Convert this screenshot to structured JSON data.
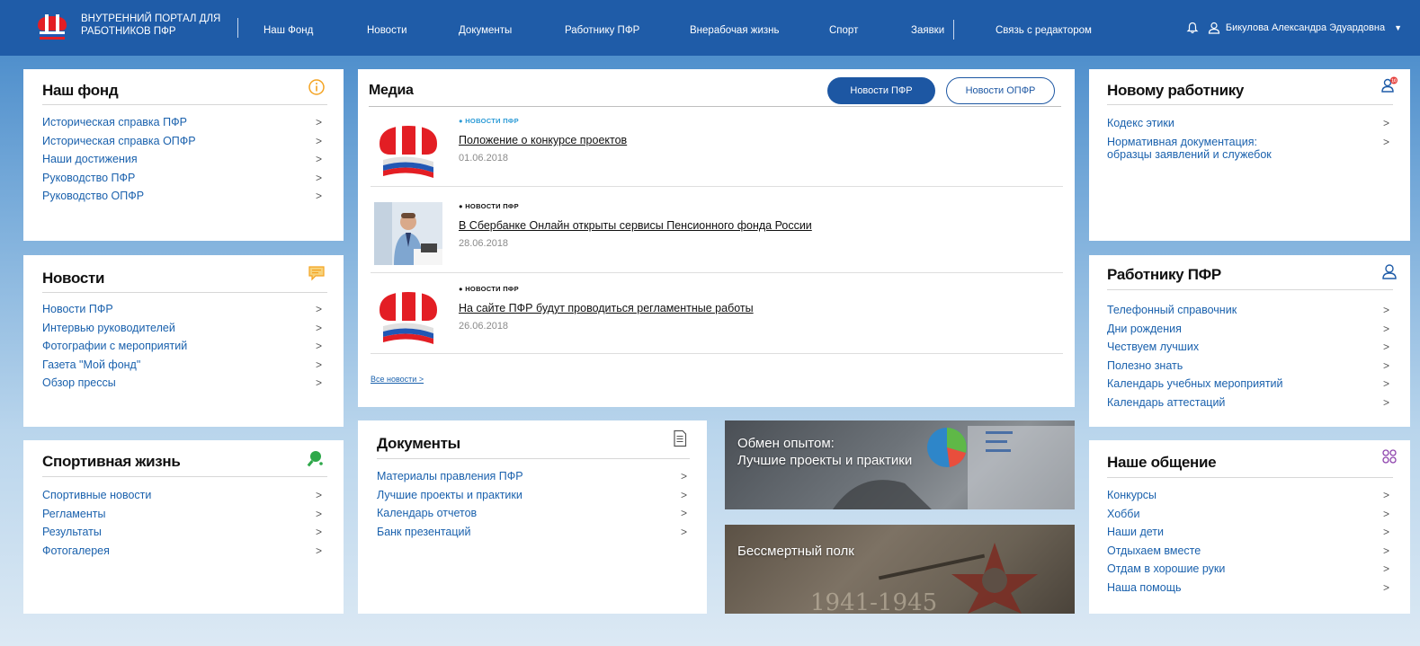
{
  "header": {
    "brand_line1": "ВНУТРЕННИЙ ПОРТАЛ ДЛЯ",
    "brand_line2": "РАБОТНИКОВ ПФР",
    "nav": [
      "Наш Фонд",
      "Новости",
      "Документы",
      "Работнику ПФР",
      "Внерабочая жизнь",
      "Спорт",
      "Заявки",
      "Связь с редактором"
    ],
    "user_name": "Бикулова Александра Эдуардовна",
    "icons": {
      "notifications": "bell-icon",
      "user": "user-icon",
      "menu": "caret-down-icon"
    }
  },
  "nash_fond": {
    "title": "Наш фонд",
    "icon": "info-icon",
    "links": [
      "Историческая справка ПФР",
      "Историческая справка ОПФР",
      "Наши достижения",
      "Руководство ПФР",
      "Руководство ОПФР"
    ]
  },
  "novosti": {
    "title": "Новости",
    "icon": "chat-icon",
    "links": [
      "Новости ПФР",
      "Интервью руководителей",
      "Фотографии с мероприятий",
      "Газета \"Мой фонд\"",
      "Обзор прессы"
    ]
  },
  "sport": {
    "title": "Спортивная жизнь",
    "icon": "ping-pong-icon",
    "links": [
      "Спортивные новости",
      "Регламенты",
      "Результаты",
      "Фотогалерея"
    ]
  },
  "media": {
    "title": "Медиа",
    "tab_pfr": "Новости ПФР",
    "tab_opfr": "Новости ОПФР",
    "items": [
      {
        "tag": "● НОВОСТИ ПФР",
        "headline": "Положение о конкурсе проектов",
        "date": "01.06.2018",
        "thumb": "pfr-logo"
      },
      {
        "tag": "● НОВОСТИ ПФР",
        "headline": "В Сбербанке Онлайн открыты сервисы Пенсионного фонда России",
        "date": "28.06.2018",
        "thumb": "photo-man-at-desk"
      },
      {
        "tag": "● НОВОСТИ ПФР",
        "headline": "На сайте ПФР будут проводиться регламентные работы",
        "date": "26.06.2018",
        "thumb": "pfr-logo"
      }
    ],
    "all_news": "Все новости >"
  },
  "documents": {
    "title": "Документы",
    "icon": "document-icon",
    "links": [
      "Материалы правления ПФР",
      "Лучшие проекты и практики",
      "Календарь отчетов",
      "Банк презентаций"
    ]
  },
  "tiles": {
    "experience_line1": "Обмен опытом:",
    "experience_line2": "Лучшие проекты и практики",
    "polk": "Бессмертный полк"
  },
  "new_worker": {
    "title": "Новому работнику",
    "icon": "user-badge-icon",
    "links": [
      "Кодекс этики",
      "Нормативная документация: образцы заявлений и служебок"
    ]
  },
  "worker_pfr": {
    "title": "Работнику ПФР",
    "icon": "user-icon",
    "links": [
      "Телефонный справочник",
      "Дни рождения",
      "Чествуем лучших",
      "Полезно знать",
      "Календарь учебных мероприятий",
      "Календарь аттестаций"
    ]
  },
  "communication": {
    "title": "Наше общение",
    "icon": "people-group-icon",
    "links": [
      "Конкурсы",
      "Хобби",
      "Наши дети",
      "Отдыхаем вместе",
      "Отдам в хорошие руки",
      "Наша помощь"
    ]
  },
  "colors": {
    "header_bg": "#1f5ca8",
    "link": "#1a61ad",
    "accent_orange": "#f4a321",
    "sport_green": "#2ea84a",
    "badge_red": "#e53935",
    "purple": "#8e44ad"
  }
}
